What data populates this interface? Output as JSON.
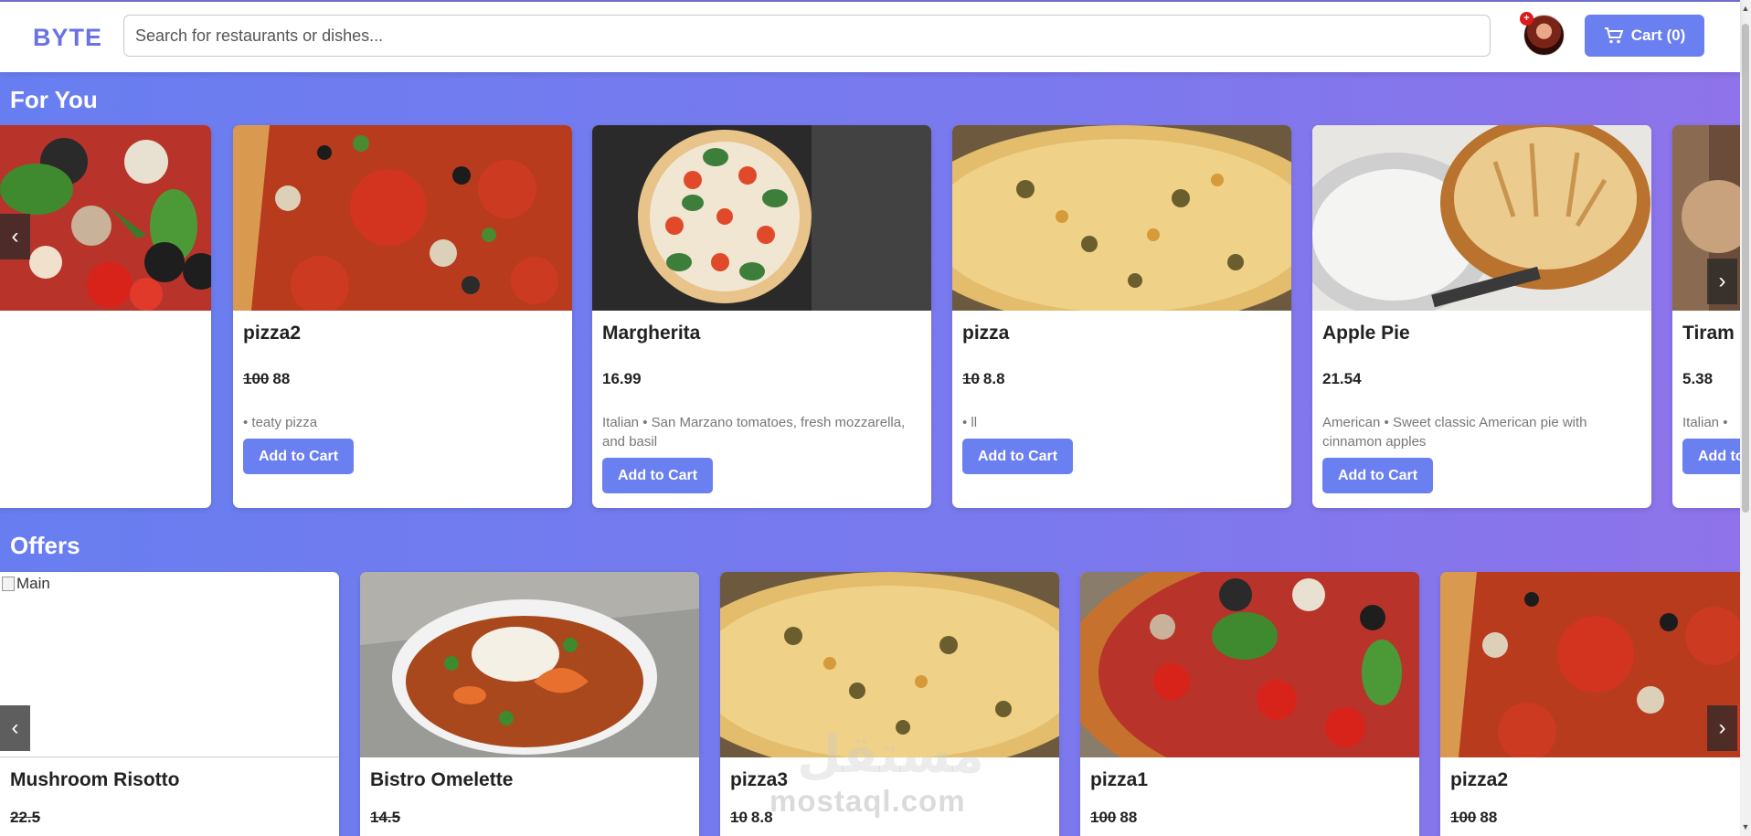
{
  "header": {
    "logo": "BYTE",
    "search_placeholder": "Search for restaurants or dishes...",
    "notification_badge": "+",
    "cart_label": "Cart (0)"
  },
  "sections": {
    "for_you": {
      "title": "For You",
      "cards": [
        {
          "name": "pizza2",
          "old_price": "100",
          "price": "88",
          "desc": "• teaty pizza",
          "button": "Add to Cart"
        },
        {
          "name": "Margherita",
          "old_price": "",
          "price": "16.99",
          "desc": "Italian • San Marzano tomatoes, fresh mozzarella, and basil",
          "button": "Add to Cart"
        },
        {
          "name": "pizza",
          "old_price": "10",
          "price": "8.8",
          "desc": "• ll",
          "button": "Add to Cart"
        },
        {
          "name": "Apple Pie",
          "old_price": "",
          "price": "21.54",
          "desc": "American • Sweet classic American pie with cinnamon apples",
          "button": "Add to Cart"
        },
        {
          "name": "Tiram",
          "old_price": "",
          "price": "5.38",
          "desc": "Italian • ",
          "button": "Add to"
        }
      ]
    },
    "offers": {
      "title": "Offers",
      "broken_image_alt": "Main",
      "cards": [
        {
          "name": "Mushroom Risotto",
          "old_price": "22.5",
          "price": ""
        },
        {
          "name": "Bistro Omelette",
          "old_price": "14.5",
          "price": ""
        },
        {
          "name": "pizza3",
          "old_price": "10",
          "price": "8.8"
        },
        {
          "name": "pizza1",
          "old_price": "100",
          "price": "88"
        },
        {
          "name": "pizza2",
          "old_price": "100",
          "price": "88"
        }
      ]
    }
  },
  "carousel": {
    "prev": "‹",
    "next": "›"
  },
  "watermark": {
    "latin": "mostaql.com",
    "arabic": "مستقل"
  },
  "colors": {
    "brand": "#6a72e4",
    "button": "#6a7ff0",
    "gradient_start": "#687ef0",
    "gradient_end": "#8e73ea"
  }
}
